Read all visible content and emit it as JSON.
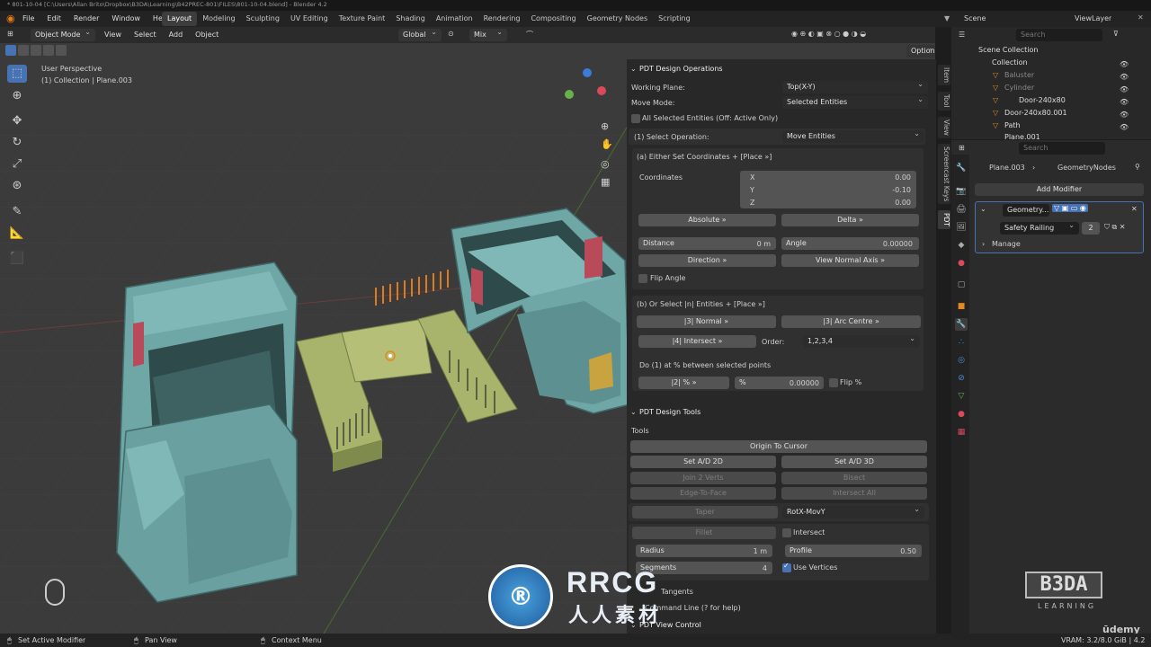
{
  "window": {
    "title": "* 801-10-04 [C:\\Users\\Allan Brito\\Dropbox\\B3DA\\Learning\\B42PREC-801\\FILES\\801-10-04.blend] - Blender 4.2"
  },
  "topbar": {
    "menus": [
      "File",
      "Edit",
      "Render",
      "Window",
      "Help"
    ],
    "workspaces": [
      "Layout",
      "Modeling",
      "Sculpting",
      "UV Editing",
      "Texture Paint",
      "Shading",
      "Animation",
      "Rendering",
      "Compositing",
      "Geometry Nodes",
      "Scripting"
    ],
    "active_workspace": "Layout",
    "scene": "Scene",
    "view_layer": "ViewLayer"
  },
  "viewport_header": {
    "mode": "Object Mode",
    "menus": [
      "View",
      "Select",
      "Add",
      "Object"
    ],
    "orientation": "Global",
    "snap": "Mix",
    "options": "Options"
  },
  "viewport": {
    "line1": "User Perspective",
    "line2": "(1) Collection | Plane.003"
  },
  "side_tabs": [
    "Item",
    "Tool",
    "View",
    "Screencast Keys",
    "PDT"
  ],
  "pdt_ops": {
    "title": "PDT Design Operations",
    "working_plane_label": "Working Plane:",
    "working_plane": "Top(X-Y)",
    "move_mode_label": "Move Mode:",
    "move_mode": "Selected Entities",
    "all_selected": "All Selected Entities (Off: Active Only)",
    "select_op_label": "(1) Select Operation:",
    "select_op": "Move Entities",
    "sec_a": "(a) Either Set Coordinates + [Place »]",
    "coords_label": "Coordinates",
    "x_label": "X",
    "x": "0.00",
    "y_label": "Y",
    "y": "-0.10",
    "z_label": "Z",
    "z": "0.00",
    "absolute": "Absolute »",
    "delta": "Delta »",
    "distance_label": "Distance",
    "distance": "0 m",
    "angle_label": "Angle",
    "angle": "0.00000",
    "direction": "Direction »",
    "view_normal": "View Normal Axis »",
    "flip_angle": "Flip Angle",
    "sec_b": "(b) Or Select |n| Entities + [Place »]",
    "normal": "|3| Normal »",
    "arc_centre": "|3| Arc Centre »",
    "intersect": "|4| Intersect »",
    "order_label": "Order:",
    "order": "1,2,3,4",
    "do_pct": "Do (1) at % between selected points",
    "pct_btn": "|2| % »",
    "pct_label": "%",
    "pct": "0.00000",
    "flip_pct": "Flip %"
  },
  "pdt_tools": {
    "title": "PDT Design Tools",
    "tools_label": "Tools",
    "origin": "Origin To Cursor",
    "ad2": "Set A/D 2D",
    "ad3": "Set A/D 3D",
    "join2": "Join 2 Verts",
    "bisect": "Bisect",
    "edge_face": "Edge-To-Face",
    "int_all": "Intersect All",
    "taper": "Taper",
    "rot": "RotX-MovY",
    "fillet": "Fillet",
    "intersect": "Intersect",
    "radius_label": "Radius",
    "radius": "1 m",
    "profile_label": "Profile",
    "profile": "0.50",
    "segments_label": "Segments",
    "segments": "4",
    "use_vertices": "Use Vertices",
    "tangents": "Tangents",
    "command_line": "Command Line (? for help)",
    "view_control": "PDT View Control"
  },
  "outliner": {
    "search": "Search",
    "items": [
      {
        "name": "Scene Collection"
      },
      {
        "name": "Collection"
      },
      {
        "name": "Baluster"
      },
      {
        "name": "Cylinder"
      },
      {
        "name": "Door-240x80"
      },
      {
        "name": "Door-240x80.001"
      },
      {
        "name": "Path"
      },
      {
        "name": "Plane.001"
      }
    ]
  },
  "properties": {
    "search": "Search",
    "object": "Plane.003",
    "modifier_name": "GeometryNodes",
    "add_modifier": "Add Modifier",
    "geo_label": "Geometry...",
    "node_group": "Safety Railing",
    "users": "2",
    "manage": "Manage"
  },
  "status": {
    "set_active": "Set Active Modifier",
    "pan": "Pan View",
    "context": "Context Menu",
    "vram": "VRAM: 3.2/8.0 GiB | 4.2"
  },
  "watermark": {
    "rrcg": "RRCG",
    "cn": "人人素材",
    "b3da": "B3DA",
    "learning": "LEARNING",
    "udemy": "ūdemy"
  }
}
